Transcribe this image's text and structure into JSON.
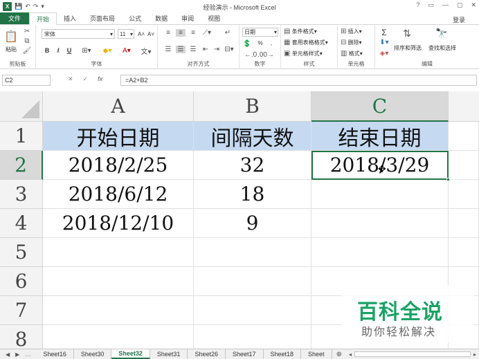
{
  "window": {
    "title": "经验演示 - Microsoft Excel",
    "controls": [
      "?",
      "▭",
      "—",
      "▢",
      "✕"
    ],
    "login": "登录"
  },
  "qat": {
    "save": "💾",
    "undo": "↶",
    "redo": "↷",
    "customize": "▾"
  },
  "tabs": [
    {
      "label": "文件",
      "kind": "file"
    },
    {
      "label": "开始",
      "kind": "active"
    },
    {
      "label": "插入",
      "kind": ""
    },
    {
      "label": "页面布局",
      "kind": ""
    },
    {
      "label": "公式",
      "kind": ""
    },
    {
      "label": "数据",
      "kind": ""
    },
    {
      "label": "审阅",
      "kind": ""
    },
    {
      "label": "视图",
      "kind": ""
    }
  ],
  "ribbon": {
    "clipboard": {
      "label": "剪贴板",
      "paste": "粘贴"
    },
    "font": {
      "label": "字体",
      "name": "宋体",
      "size": "11",
      "grow": "A˄",
      "shrink": "A˅",
      "bold": "B",
      "italic": "I",
      "underline": "U"
    },
    "alignment": {
      "label": "对齐方式"
    },
    "number": {
      "label": "数字",
      "format": "日期",
      "percent": "%",
      "comma": ","
    },
    "styles": {
      "label": "样式",
      "conditional": "条件格式",
      "table": "套用表格格式",
      "cell": "单元格样式"
    },
    "cells": {
      "label": "单元格",
      "insert": "插入",
      "delete": "删除",
      "format": "格式"
    },
    "editing": {
      "label": "编辑",
      "sort": "排序和筛选",
      "find": "查找和选择",
      "sum": "Σ"
    }
  },
  "formula_bar": {
    "name_box": "C2",
    "cancel": "✕",
    "enter": "✓",
    "fx": "fx",
    "formula": "=A2+B2"
  },
  "grid": {
    "columns": [
      "A",
      "B",
      "C"
    ],
    "rows": [
      "1",
      "2",
      "3",
      "4",
      "5",
      "6",
      "7",
      "8"
    ],
    "header_row": [
      "开始日期",
      "间隔天数",
      "结束日期"
    ],
    "data": [
      [
        "2018/2/25",
        "32",
        "2018/3/29"
      ],
      [
        "2018/6/12",
        "18",
        ""
      ],
      [
        "2018/12/10",
        "9",
        ""
      ]
    ]
  },
  "watermark": {
    "main": "百科全说",
    "sub": "助你轻松解决"
  },
  "sheets": [
    "Sheet16",
    "Sheet30",
    "Sheet32",
    "Sheet31",
    "Sheet26",
    "Sheet17",
    "Sheet18",
    "Sheet"
  ],
  "active_sheet": "Sheet32",
  "colors": {
    "excel_green": "#217346",
    "header_fill": "#c5d9f1",
    "watermark_green": "#1aa364"
  }
}
